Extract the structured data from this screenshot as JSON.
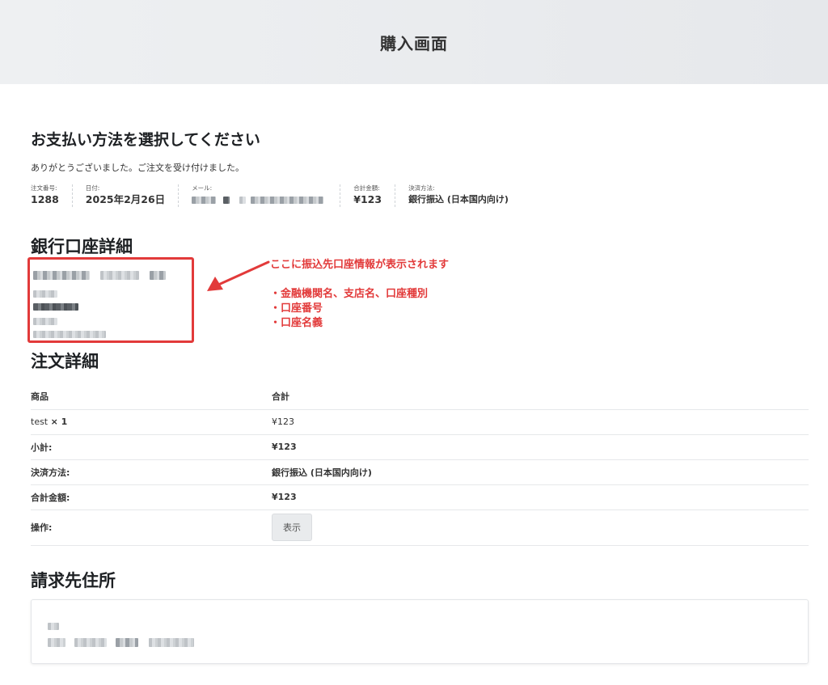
{
  "header": {
    "title": "購入画面"
  },
  "payment": {
    "title": "お支払い方法を選択してください",
    "thanks": "ありがとうございました。ご注文を受け付けました。"
  },
  "overview": {
    "order_number": {
      "label": "注文番号:",
      "value": "1288"
    },
    "date": {
      "label": "日付:",
      "value": "2025年2月26日"
    },
    "email": {
      "label": "メール:"
    },
    "total": {
      "label": "合計金額:",
      "value": "¥123"
    },
    "method": {
      "label": "決済方法:",
      "value": "銀行振込 (日本国内向け)"
    }
  },
  "bank": {
    "title": "銀行口座詳細"
  },
  "annotation": {
    "headline": "ここに振込先口座情報が表示されます",
    "bullets": [
      "・金融機関名、支店名、口座種別",
      "・口座番号",
      "・口座名義"
    ],
    "color": "#e23a3a"
  },
  "order": {
    "title": "注文詳細",
    "header": {
      "product": "商品",
      "total": "合計"
    },
    "item": {
      "name": "test",
      "qty": "× 1",
      "price": "¥123"
    },
    "subtotal": {
      "label": "小計:",
      "value": "¥123"
    },
    "method": {
      "label": "決済方法:",
      "value": "銀行振込 (日本国内向け)"
    },
    "total": {
      "label": "合計金額:",
      "value": "¥123"
    },
    "action": {
      "label": "操作:",
      "button": "表示"
    }
  },
  "billing": {
    "title": "請求先住所"
  }
}
